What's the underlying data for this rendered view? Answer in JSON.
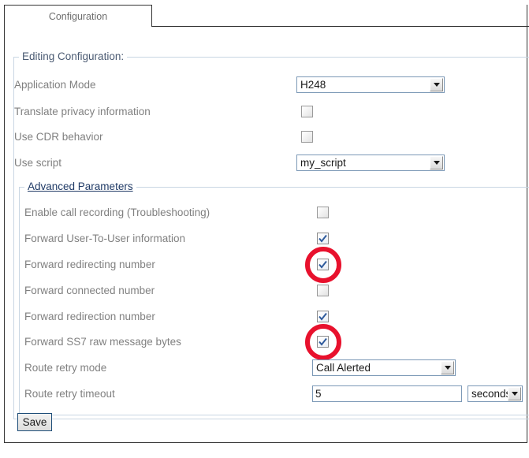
{
  "tab": {
    "label": "Configuration"
  },
  "fieldsets": {
    "editing_legend": "Editing Configuration:",
    "advanced_legend": "Advanced Parameters"
  },
  "rows": [
    {
      "label": "Application Mode",
      "control": "select",
      "value": "H248"
    },
    {
      "label": "Translate privacy information",
      "control": "checkbox",
      "checked": false
    },
    {
      "label": "Use CDR behavior",
      "control": "checkbox",
      "checked": false
    },
    {
      "label": "Use script",
      "control": "select",
      "value": "my_script"
    },
    {
      "label": "Enable call recording (Troubleshooting)",
      "control": "checkbox",
      "checked": false
    },
    {
      "label": "Forward User-To-User information",
      "control": "checkbox",
      "checked": true
    },
    {
      "label": "Forward redirecting number",
      "control": "checkbox",
      "checked": true,
      "highlighted": true
    },
    {
      "label": "Forward connected number",
      "control": "checkbox",
      "checked": false
    },
    {
      "label": "Forward redirection number",
      "control": "checkbox",
      "checked": true
    },
    {
      "label": "Forward SS7 raw message bytes",
      "control": "checkbox",
      "checked": true,
      "highlighted": true
    },
    {
      "label": "Route retry mode",
      "control": "select",
      "value": "Call Alerted"
    },
    {
      "label": "Route retry timeout",
      "control": "text",
      "value": "5",
      "unit": "seconds"
    }
  ],
  "buttons": {
    "save_label": "Save"
  },
  "icons": {
    "dropdown_arrow": "chevron-down-icon",
    "checkmark": "check-icon",
    "annotation": "red-circle-highlight"
  },
  "colors": {
    "annotation_red": "#e8112d",
    "checkmark_blue": "#2f5b9c",
    "label_gray": "#808080",
    "legend_blue": "#1f3a66",
    "fieldset_border": "#c9d6e3",
    "control_border": "#7b98b6"
  }
}
